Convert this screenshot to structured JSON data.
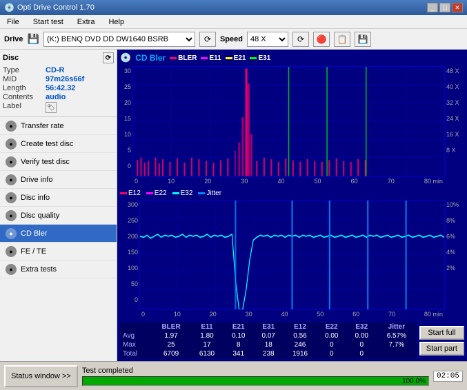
{
  "titlebar": {
    "title": "Opti Drive Control 1.70",
    "controls": [
      "_",
      "□",
      "✕"
    ]
  },
  "menu": {
    "items": [
      "File",
      "Start test",
      "Extra",
      "Help"
    ]
  },
  "toolbar": {
    "drive_label": "Drive",
    "drive_value": "(K:)  BENQ DVD DD DW1640 BSRB",
    "speed_label": "Speed",
    "speed_value": "48 X"
  },
  "disc": {
    "header": "Disc",
    "type_label": "Type",
    "type_value": "CD-R",
    "mid_label": "MID",
    "mid_value": "97m26s66f",
    "length_label": "Length",
    "length_value": "56:42.32",
    "contents_label": "Contents",
    "contents_value": "audio",
    "label_label": "Label"
  },
  "nav": {
    "items": [
      {
        "id": "transfer-rate",
        "label": "Transfer rate",
        "active": false
      },
      {
        "id": "create-test-disc",
        "label": "Create test disc",
        "active": false
      },
      {
        "id": "verify-test-disc",
        "label": "Verify test disc",
        "active": false
      },
      {
        "id": "drive-info",
        "label": "Drive info",
        "active": false
      },
      {
        "id": "disc-info",
        "label": "Disc info",
        "active": false
      },
      {
        "id": "disc-quality",
        "label": "Disc quality",
        "active": false
      },
      {
        "id": "cd-bler",
        "label": "CD Bler",
        "active": true
      },
      {
        "id": "fe-te",
        "label": "FE / TE",
        "active": false
      },
      {
        "id": "extra-tests",
        "label": "Extra tests",
        "active": false
      }
    ]
  },
  "chart": {
    "title": "CD Bler",
    "top_legend": [
      "BLER",
      "E11",
      "E21",
      "E31"
    ],
    "top_legend_colors": [
      "#ff0066",
      "#ff00ff",
      "#ffff00",
      "#00ff00"
    ],
    "bottom_legend": [
      "E12",
      "E22",
      "E32",
      "Jitter"
    ],
    "bottom_legend_colors": [
      "#ff0066",
      "#ff00ff",
      "#00ffff",
      "#0088ff"
    ],
    "x_max": 80,
    "top_y_max": 30,
    "top_right_labels": [
      "48 X",
      "40 X",
      "32 X",
      "24 X",
      "16 X",
      "8 X"
    ],
    "bottom_y_max": 300,
    "bottom_right_labels": [
      "10%",
      "8%",
      "6%",
      "4%",
      "2%"
    ]
  },
  "stats": {
    "headers": [
      "",
      "BLER",
      "E11",
      "E21",
      "E31",
      "E12",
      "E22",
      "E32",
      "Jitter",
      ""
    ],
    "rows": [
      {
        "label": "Avg",
        "bler": "1.97",
        "e11": "1.80",
        "e21": "0.10",
        "e31": "0.07",
        "e12": "0.56",
        "e22": "0.00",
        "e32": "0.00",
        "jitter": "6.57%"
      },
      {
        "label": "Max",
        "bler": "25",
        "e11": "17",
        "e21": "8",
        "e31": "18",
        "e12": "246",
        "e22": "0",
        "e32": "0",
        "jitter": "7.7%"
      },
      {
        "label": "Total",
        "bler": "6709",
        "e11": "6130",
        "e21": "341",
        "e31": "238",
        "e12": "1916",
        "e22": "0",
        "e32": "0",
        "jitter": ""
      }
    ],
    "start_full": "Start full",
    "start_part": "Start part"
  },
  "statusbar": {
    "status_window_btn": "Status window >>",
    "status_text": "Test completed",
    "progress_value": "100.0%",
    "time": "02:05"
  }
}
